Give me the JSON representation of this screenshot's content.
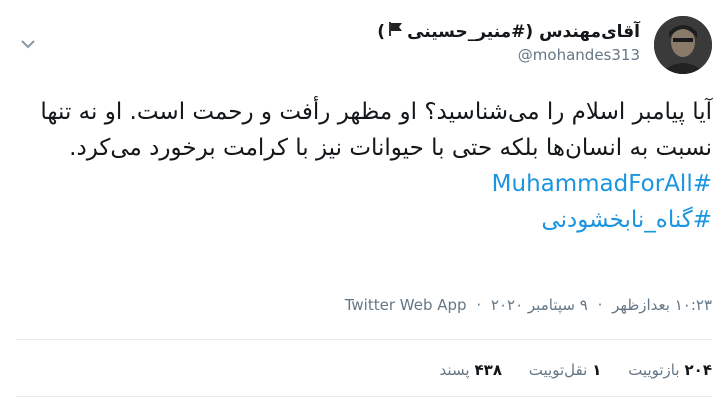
{
  "author": {
    "display_name_prefix": "آقای‌مهندس (#منیر_حسینی",
    "display_name_suffix": ")",
    "handle": "@mohandes313",
    "avatar_icon": "profile-photo",
    "flag_icon": "black-flag"
  },
  "tweet": {
    "text": "آیا پیامبر اسلام را می‌شناسید؟ او مظهر رأفت و رحمت است. او نه تنها نسبت به انسان‌ها بلکه حتی با حیوانات نیز با کرامت برخورد می‌کرد.",
    "hashtags": [
      "#MuhammadForAll",
      "#گناه_نابخشودنی"
    ]
  },
  "meta": {
    "time": "۱۰:۲۳ بعدازظهر",
    "date": "۹ سپتامبر ۲۰۲۰",
    "separator": "·",
    "client": "Twitter Web App"
  },
  "stats": {
    "retweets_count": "۲۰۴",
    "retweets_label": "بازتوییت",
    "quotes_count": "۱",
    "quotes_label": "نقل‌توییت",
    "likes_count": "۴۳۸",
    "likes_label": "پسند"
  },
  "colors": {
    "link": "#1b95e0",
    "secondary_text": "#657786",
    "primary_text": "#14171a",
    "divider": "#e6ecf0"
  }
}
